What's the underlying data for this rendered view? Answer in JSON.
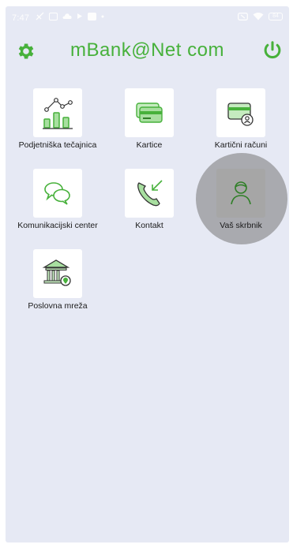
{
  "status_bar": {
    "time": "7:47",
    "battery": "84"
  },
  "header": {
    "title": "mBank@Net com"
  },
  "tiles": [
    {
      "label": "Podjetniška tečajnica",
      "icon": "chart-icon"
    },
    {
      "label": "Kartice",
      "icon": "cards-icon"
    },
    {
      "label": "Kartični računi",
      "icon": "card-account-icon"
    },
    {
      "label": "Komunikacijski center",
      "icon": "chat-icon"
    },
    {
      "label": "Kontakt",
      "icon": "phone-icon"
    },
    {
      "label": "Vaš skrbnik",
      "icon": "advisor-icon"
    },
    {
      "label": "Poslovna mreža",
      "icon": "bank-branch-icon"
    }
  ],
  "colors": {
    "accent": "#47b13b",
    "background": "#e6e9f4"
  }
}
